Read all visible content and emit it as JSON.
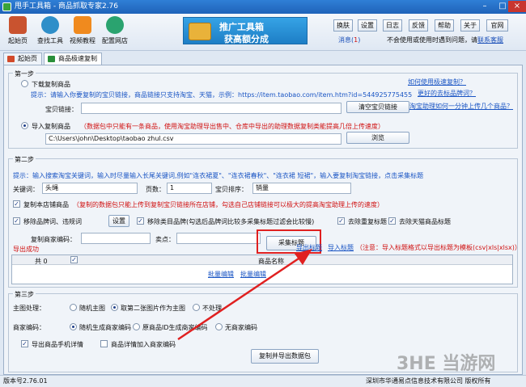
{
  "window": {
    "title": "甩手工具箱 - 商品抓取专家2.76"
  },
  "toolbar": {
    "buttons": [
      {
        "label": "起始页",
        "icon": "home-icon"
      },
      {
        "label": "查找工具",
        "icon": "search-icon"
      },
      {
        "label": "视频教程",
        "icon": "play-icon"
      },
      {
        "label": "配置网店",
        "icon": "gear-icon"
      }
    ]
  },
  "banner": {
    "line1": "推广工具箱",
    "line2": "获高额分成"
  },
  "top_buttons": [
    "换肤",
    "设置",
    "日志",
    "反馈",
    "帮助",
    "关于",
    "官网"
  ],
  "messages": {
    "label": "消息(",
    "count": "1",
    "close": ")"
  },
  "hint": {
    "text": "不会使用或使用时遇到问题，请",
    "link": "联系客服"
  },
  "tabs": [
    {
      "label": "起始页",
      "active": false
    },
    {
      "label": "商品极速复制",
      "active": true
    }
  ],
  "step1": {
    "title": "第一步",
    "download_label": "下载复制商品",
    "tip": "提示：请输入你要复制的宝贝链接，商品链接只支持淘宝、天猫，示例：https://item.taobao.com/item.htm?id=544925775455",
    "link_label": "宝贝链接：",
    "link_value": "",
    "clear_button": "清空宝贝链接",
    "import_label": "导入复制商品",
    "import_tip": "（数据包中只能有一条商品，使用淘宝助理导出售中、仓库中导出的助理数据复制类能提高几倍上传速度）",
    "file_path": "C:\\Users\\john\\Desktop\\taobao zhul.csv",
    "browse_button": "浏览",
    "help_links": [
      "如何使用极速复制？",
      "更好的去标品牌词？",
      "淘宝助理如何一分钟上传几个商品？"
    ]
  },
  "step2": {
    "title": "第二步",
    "tip": "提示：输入搜索淘宝关键词，输入时尽量输入长尾关键词,例如\"连衣裙夏\"、\"连衣裙春秋\"、\"连衣裙 短裙\"，输入要复制淘宝链接，点击采集标题",
    "keyword_label": "关键词：",
    "keyword_value": "头绳",
    "pages_label": "页数：",
    "pages_value": "1",
    "sort_label": "宝贝排序：",
    "sort_value": "销量",
    "copy_store": "复制本店铺商品",
    "copy_store_tip": "（复制的数据包只能上传到复制宝贝链接所在店铺，勾选自己店铺链接可以极大的提高淘宝助理上传的速度）",
    "remove_brand": "移除品牌词、违规词",
    "settings_button": "设置",
    "remove_brand_cat": "移除类目品牌(勾选后品牌词比较多采集标题过滤会比较慢)",
    "remove_dup": "去除重复标题",
    "remove_tmall": "去除天猫商品标题",
    "merchant_code_label": "复制商家编码：",
    "sell_point_label": "卖点：",
    "collect_button": "采集标题",
    "export_title_link": "导出标题",
    "import_title_link": "导入标题",
    "import_note": "（注意：导入标题格式以导出标题为模板(csv|xls|xlsx)）",
    "export_status": "导出成功",
    "table": {
      "count_header": "共 0",
      "name_header": "商品名称",
      "batch_edit_1": "批量编辑",
      "batch_edit_2": "批量编辑"
    }
  },
  "step3": {
    "title": "第三步",
    "image_label": "主图处理：",
    "image_options": [
      "随机主图",
      "取第二张图片作为主图",
      "不处理"
    ],
    "code_label": "商家编码：",
    "code_options": [
      "随机生成商家编码",
      "原商品ID生成商家编码",
      "无商家编码"
    ],
    "export_mobile": "导出商品手机详情",
    "add_code_detail": "商品详情加入商家编码",
    "copy_export_button": "复制并导出数据包"
  },
  "statusbar": {
    "version": "版本号2.76.01",
    "company": "深圳市华通易点信息技术有限公司 版权所有"
  },
  "watermark": "3HE 当游网"
}
